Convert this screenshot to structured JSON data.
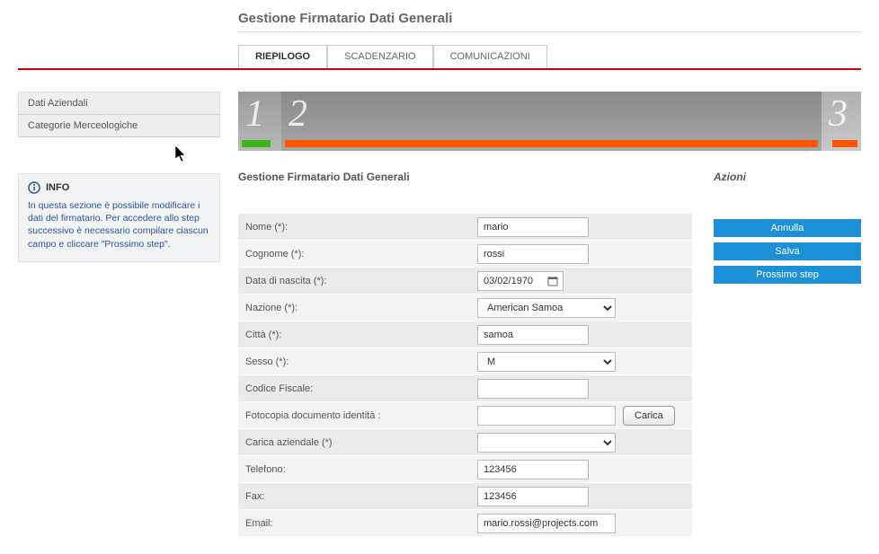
{
  "page": {
    "title": "Gestione Firmatario Dati Generali"
  },
  "tabs": {
    "riepilogo": "RIEPILOGO",
    "scadenzario": "SCADENZARIO",
    "comunicazioni": "COMUNICAZIONI"
  },
  "sidebar": {
    "items": [
      "Dati Aziendali",
      "Categorie Merceologiche"
    ]
  },
  "infoBox": {
    "title": "INFO",
    "text": "In questa sezione è possibile modificare i dati del firmatario. Per accedere allo step successivo è necessario compilare ciascun campo e cliccare \"Prossimo step\"."
  },
  "stepper": {
    "step1": "1",
    "step2": "2",
    "step3": "3"
  },
  "form": {
    "sectionTitle": "Gestione Firmatario Dati Generali",
    "labels": {
      "nome": "Nome (*):",
      "cognome": "Cognome (*):",
      "dataNascita": "Data di nascita (*):",
      "nazione": "Nazione (*):",
      "citta": "Città (*):",
      "sesso": "Sesso (*):",
      "codiceFiscale": "Codice Fiscale:",
      "fotocopia": "Fotocopia documento identità :",
      "caricaAziendale": "Carica aziendale (*)",
      "telefono": "Telefono:",
      "fax": "Fax:",
      "email": "Email:"
    },
    "values": {
      "nome": "mario",
      "cognome": "rossi",
      "dataNascita": "03/02/1970",
      "nazione": "American Samoa",
      "citta": "samoa",
      "sesso": "M",
      "codiceFiscale": "",
      "fotocopia": "",
      "caricaAziendale": "",
      "telefono": "123456",
      "fax": "123456",
      "email": "mario.rossi@projects.com"
    },
    "buttons": {
      "carica": "Carica"
    }
  },
  "actions": {
    "title": "Azioni",
    "annulla": "Annulla",
    "salva": "Salva",
    "prossimoStep": "Prossimo step"
  }
}
